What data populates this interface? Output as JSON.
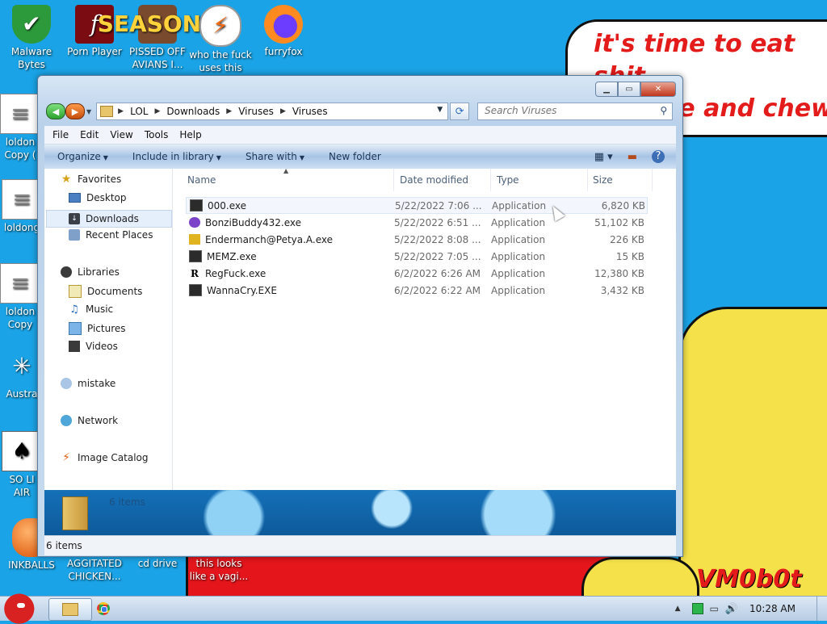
{
  "desktop": {
    "speech_text": "it's time to eat shit\nand die and chew\ngum",
    "watermark": "VM0b0t",
    "icons": [
      {
        "label": "Malware\nBytes",
        "icon": "shield-icon"
      },
      {
        "label": "Porn Player",
        "icon": "flash-icon"
      },
      {
        "label": "PISSED OFF AVIANS I...",
        "icon": "birds-icon",
        "badge": "SEASONS"
      },
      {
        "label": "who the fuck uses this",
        "icon": "bolt-icon"
      },
      {
        "label": "furryfox",
        "icon": "fox-icon"
      },
      {
        "label": "loldon\nCopy (",
        "icon": "document-icon"
      },
      {
        "label": "loldong",
        "icon": "document-icon"
      },
      {
        "label": "loldon\nCopy",
        "icon": "document-icon"
      },
      {
        "label": "Austra",
        "icon": "spider-icon"
      },
      {
        "label": "SO LI\nAIR",
        "icon": "cards-icon"
      },
      {
        "label": "INKBALLS",
        "icon": "ball-icon"
      },
      {
        "label": "AGGITATED CHICKEN...",
        "icon": "chicken-icon"
      },
      {
        "label": "cd drive",
        "icon": "drive-icon"
      },
      {
        "label": "this looks like a vagi...",
        "icon": "image-icon"
      }
    ]
  },
  "window": {
    "address": {
      "crumbs": [
        "LOL",
        "Downloads",
        "Viruses",
        "Viruses"
      ]
    },
    "search_placeholder": "Search Viruses",
    "menu": [
      "File",
      "Edit",
      "View",
      "Tools",
      "Help"
    ],
    "commands": {
      "organize": "Organize",
      "include": "Include in library",
      "share": "Share with",
      "new_folder": "New folder"
    },
    "nav": {
      "favorites": "Favorites",
      "desktop": "Desktop",
      "downloads": "Downloads",
      "recent": "Recent Places",
      "libraries": "Libraries",
      "documents": "Documents",
      "music": "Music",
      "pictures": "Pictures",
      "videos": "Videos",
      "homegroup": "mistake",
      "network": "Network",
      "catalog": "Image Catalog"
    },
    "columns": {
      "name": "Name",
      "date": "Date modified",
      "type": "Type",
      "size": "Size"
    },
    "files": [
      {
        "name": "000.exe",
        "date": "5/22/2022 7:06 ...",
        "type": "Application",
        "size": "6,820 KB"
      },
      {
        "name": "BonziBuddy432.exe",
        "date": "5/22/2022 6:51 ...",
        "type": "Application",
        "size": "51,102 KB"
      },
      {
        "name": "Endermanch@Petya.A.exe",
        "date": "5/22/2022 8:08 ...",
        "type": "Application",
        "size": "226 KB"
      },
      {
        "name": "MEMZ.exe",
        "date": "5/22/2022 7:05 ...",
        "type": "Application",
        "size": "15 KB"
      },
      {
        "name": "RegFuck.exe",
        "date": "6/2/2022 6:26 AM",
        "type": "Application",
        "size": "12,380 KB"
      },
      {
        "name": "WannaCry.EXE",
        "date": "6/2/2022 6:22 AM",
        "type": "Application",
        "size": "3,432 KB"
      }
    ],
    "details_count": "6 items",
    "status_count": "6 items"
  },
  "taskbar": {
    "clock": "10:28 AM"
  }
}
